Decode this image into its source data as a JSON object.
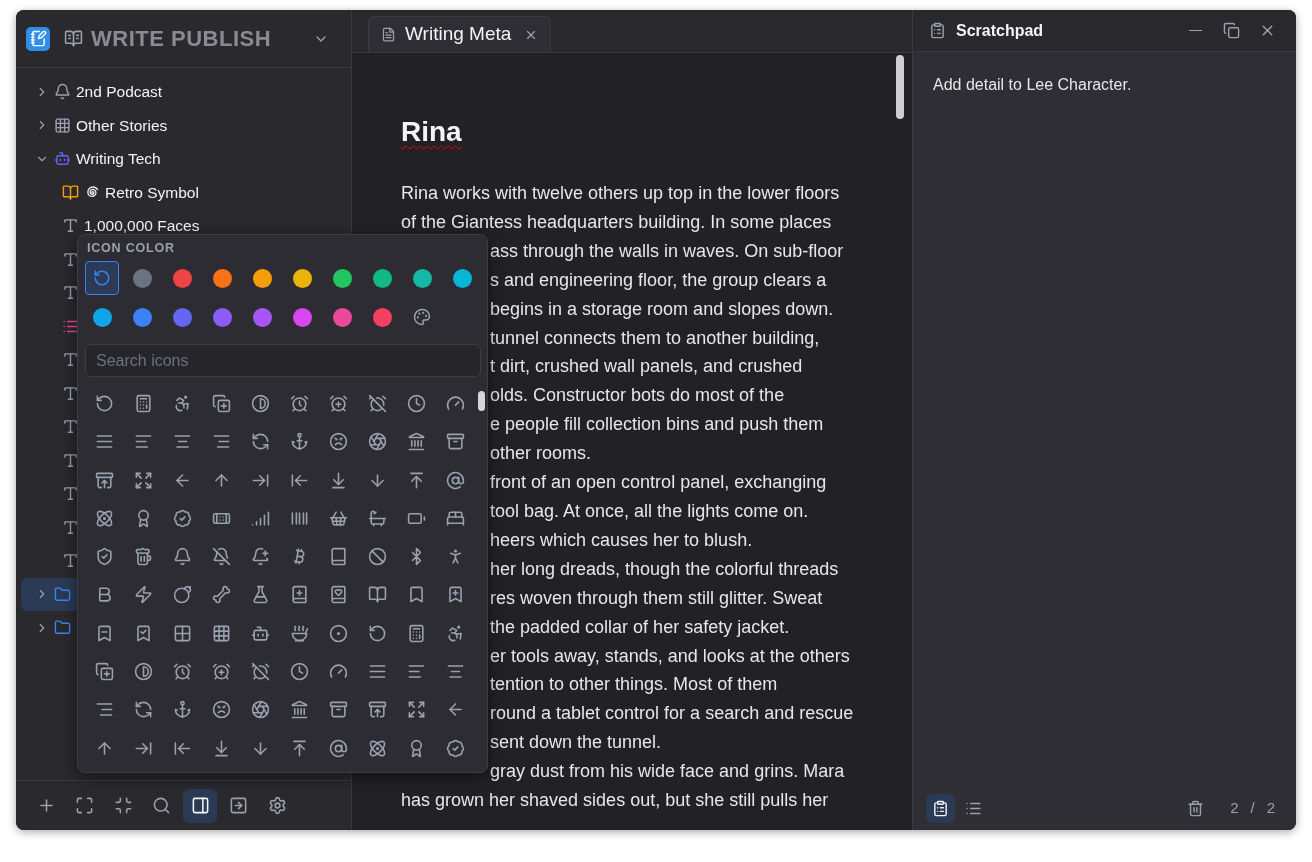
{
  "app": {
    "title": "WRITE PUBLISH"
  },
  "tree": [
    {
      "label": "2nd Podcast",
      "kind": "bell",
      "expanded": false,
      "selected": false
    },
    {
      "label": "Other Stories",
      "kind": "grid",
      "expanded": false,
      "selected": false
    },
    {
      "label": "Writing Tech",
      "kind": "robot",
      "expanded": true,
      "selected": false,
      "children": [
        {
          "label": "Retro Symbol",
          "kind": "book"
        },
        {
          "label": "1,000,000 Faces",
          "kind": "text"
        },
        {
          "kind": "text"
        },
        {
          "kind": "text"
        },
        {
          "kind": "list"
        },
        {
          "kind": "text"
        },
        {
          "kind": "text"
        },
        {
          "kind": "text"
        },
        {
          "kind": "text"
        },
        {
          "kind": "text"
        },
        {
          "kind": "text"
        },
        {
          "kind": "text"
        }
      ]
    },
    {
      "kind": "folder",
      "expanded": false,
      "selected": true
    },
    {
      "kind": "folder",
      "expanded": false,
      "selected": false
    }
  ],
  "sidebar_toolbar": [
    {
      "kind": "add",
      "selected": false
    },
    {
      "kind": "expand",
      "selected": false
    },
    {
      "kind": "collapse",
      "selected": false
    },
    {
      "kind": "search",
      "selected": false
    },
    {
      "kind": "panel",
      "selected": true
    },
    {
      "kind": "exit",
      "selected": false
    },
    {
      "kind": "settings",
      "selected": false
    }
  ],
  "icon_picker": {
    "heading": "ICON COLOR",
    "search": {
      "placeholder": "Search icons"
    },
    "swatches": [
      {
        "kind": "default",
        "selected": true
      },
      {
        "kind": "color",
        "color": "#6b7280",
        "selected": false
      },
      {
        "kind": "color",
        "color": "#ef4444",
        "selected": false
      },
      {
        "kind": "color",
        "color": "#f97316",
        "selected": false
      },
      {
        "kind": "color",
        "color": "#f59e0b",
        "selected": false
      },
      {
        "kind": "color",
        "color": "#eab308",
        "selected": false
      },
      {
        "kind": "color",
        "color": "#22c55e",
        "selected": false
      },
      {
        "kind": "color",
        "color": "#10b981",
        "selected": false
      },
      {
        "kind": "color",
        "color": "#14b8a6",
        "selected": false
      },
      {
        "kind": "color",
        "color": "#06b6d4",
        "selected": false
      },
      {
        "kind": "color",
        "color": "#0ea5e9",
        "selected": false
      },
      {
        "kind": "color",
        "color": "#3b82f6",
        "selected": false
      },
      {
        "kind": "color",
        "color": "#6366f1",
        "selected": false
      },
      {
        "kind": "color",
        "color": "#8b5cf6",
        "selected": false
      },
      {
        "kind": "color",
        "color": "#a855f7",
        "selected": false
      },
      {
        "kind": "color",
        "color": "#d946ef",
        "selected": false
      },
      {
        "kind": "color",
        "color": "#ec4899",
        "selected": false
      },
      {
        "kind": "color",
        "color": "#f43f5e",
        "selected": false
      },
      {
        "kind": "custom",
        "selected": false
      }
    ]
  },
  "editor": {
    "tabs": [
      {
        "title": "Writing Meta",
        "selected": true
      }
    ],
    "heading": "Rina",
    "lines": [
      {
        "text": "Rina works with twelve others up top in the lower floors",
        "covered": false
      },
      {
        "text": "of the Giantess headquarters building. In some places",
        "covered": false
      },
      {
        "text": "ass through the walls in waves. On sub-floor",
        "covered": true
      },
      {
        "text": "s and engineering floor, the group clears a",
        "covered": true
      },
      {
        "text": "begins in a storage room and slopes down.",
        "covered": true
      },
      {
        "text": "tunnel connects them to another building,",
        "covered": true
      },
      {
        "text": "t dirt, crushed wall panels, and crushed",
        "covered": true
      },
      {
        "text": "olds. Constructor bots do most of the",
        "covered": true
      },
      {
        "text": "e people fill collection bins and push them",
        "covered": true
      },
      {
        "text": "other rooms.",
        "covered": true
      },
      {
        "text": "front of an open control panel, exchanging",
        "covered": true
      },
      {
        "text": "tool bag. At once, all the lights come on.",
        "covered": true
      },
      {
        "text": "heers which causes her to blush.",
        "covered": true
      },
      {
        "text": "her long dreads, though the colorful threads",
        "covered": true
      },
      {
        "text": "res woven through them still glitter. Sweat",
        "covered": true
      },
      {
        "text": "the padded collar of her safety jacket.",
        "covered": true
      },
      {
        "text": "er tools away, stands, and looks at the others",
        "covered": true
      },
      {
        "text": "tention to other things. Most of them",
        "covered": true
      },
      {
        "text": "round a tablet control for a search and rescue",
        "covered": true
      },
      {
        "text": "sent down the tunnel.",
        "covered": true
      },
      {
        "text": "gray dust from his wide face and grins. Mara",
        "covered": true
      },
      {
        "text": "has grown her shaved sides out, but she still pulls her",
        "covered": false
      }
    ]
  },
  "scratchpad": {
    "title": "Scratchpad",
    "note": "Add detail to Lee Character.",
    "views": [
      {
        "kind": "note",
        "selected": true
      },
      {
        "kind": "list",
        "selected": false
      }
    ],
    "page": "2",
    "separator": "/",
    "total": "2"
  }
}
